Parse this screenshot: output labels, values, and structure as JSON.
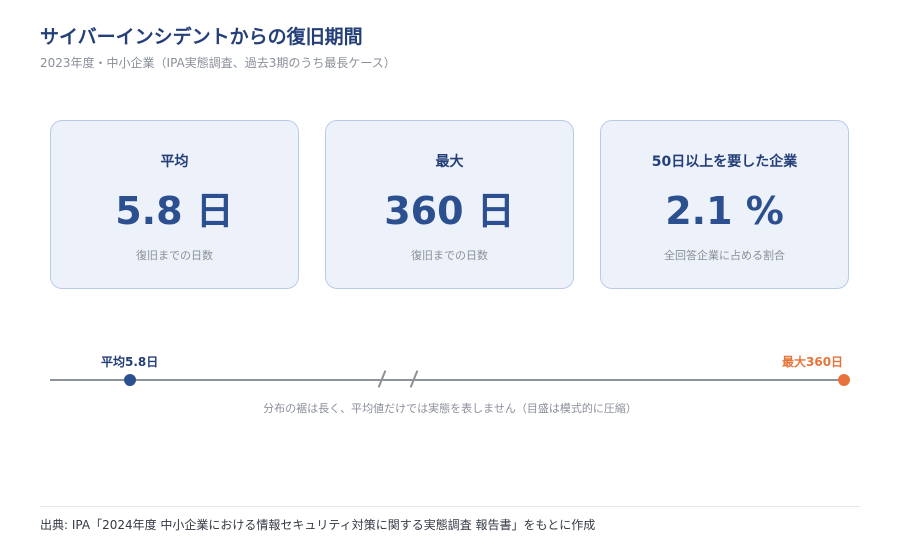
{
  "header": {
    "title": "サイバーインシデントからの復旧期間",
    "subtitle": "2023年度・中小企業（IPA実態調査、過去3期のうち最長ケース）"
  },
  "cards": [
    {
      "label": "平均",
      "value": "5.8 日",
      "desc": "復旧までの日数"
    },
    {
      "label": "最大",
      "value": "360 日",
      "desc": "復旧までの日数"
    },
    {
      "label": "50日以上を要した企業",
      "value": "2.1 %",
      "desc": "全回答企業に占める割合"
    }
  ],
  "timeline": {
    "avg_label": "平均5.8日",
    "max_label": "最大360日",
    "note": "分布の裾は長く、平均値だけでは実態を表しません（目盛は模式的に圧縮）",
    "avg_color": "#2c4f8f",
    "max_color": "#e8733a"
  },
  "footer": {
    "source": "出典: IPA「2024年度 中小企業における情報セキュリティ対策に関する実態調査 報告書」をもとに作成"
  }
}
